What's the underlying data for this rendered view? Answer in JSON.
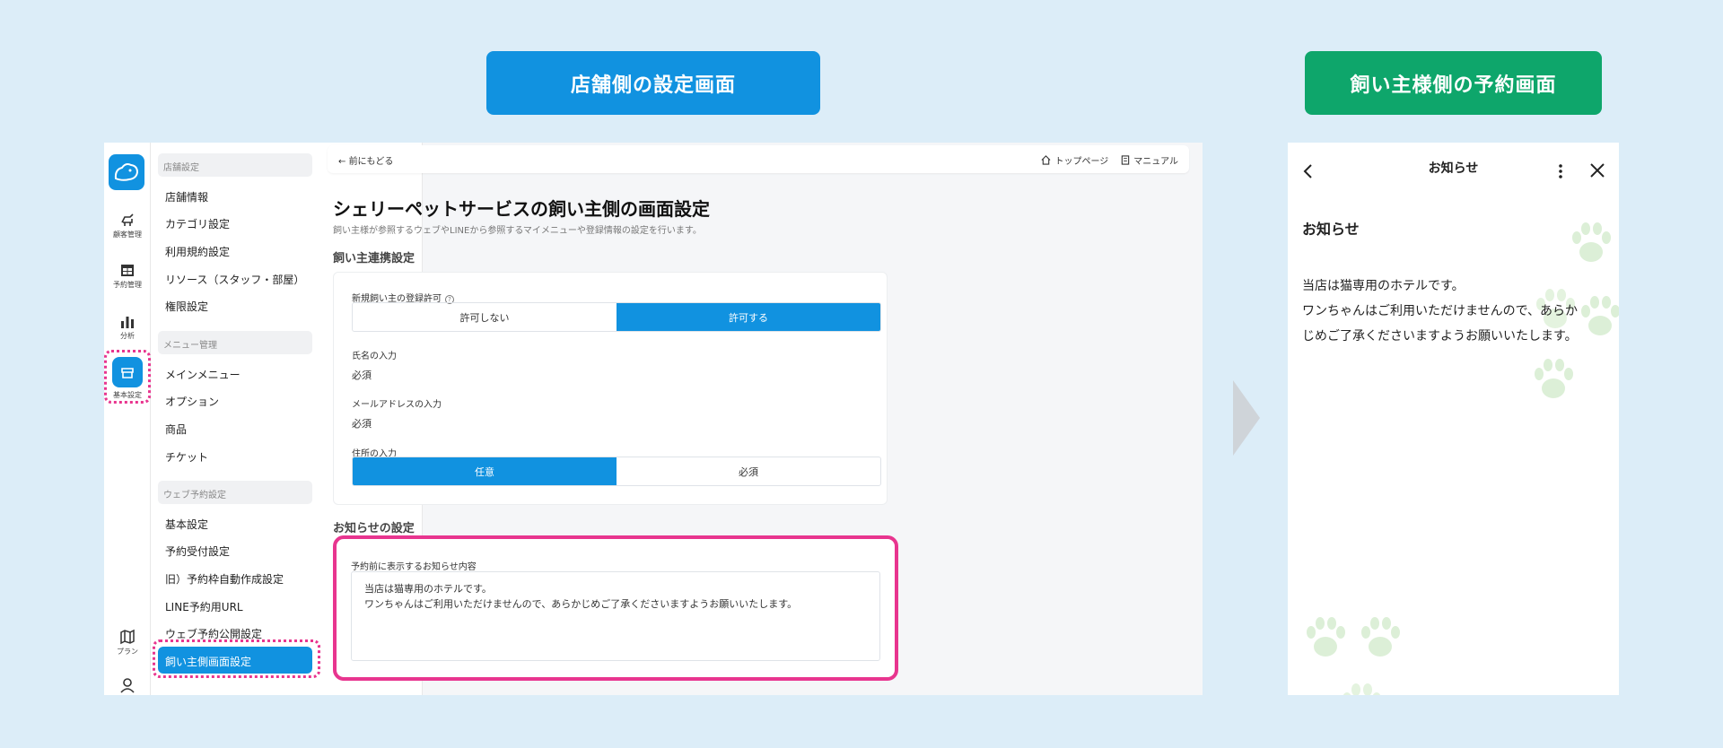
{
  "banners": {
    "store": "店舗側の設定画面",
    "owner": "飼い主様側の予約画面"
  },
  "colors": {
    "primary": "#1192e0",
    "owner_banner": "#0ea66b",
    "highlight": "#e8358f",
    "background": "#dcedf8"
  },
  "iconbar": {
    "items": [
      {
        "label": "顧客管理",
        "icon": "dog-icon"
      },
      {
        "label": "予約管理",
        "icon": "calendar-icon"
      },
      {
        "label": "分析",
        "icon": "bar-chart-icon"
      },
      {
        "label": "基本設定",
        "icon": "store-icon",
        "active": true
      },
      {
        "label": "プラン",
        "icon": "map-icon"
      }
    ]
  },
  "menu": {
    "sections": [
      {
        "title": "店舗設定",
        "items": [
          "店舗情報",
          "カテゴリ設定",
          "利用規約設定",
          "リソース（スタッフ・部屋）",
          "権限設定"
        ]
      },
      {
        "title": "メニュー管理",
        "items": [
          "メインメニュー",
          "オプション",
          "商品",
          "チケット"
        ]
      },
      {
        "title": "ウェブ予約設定",
        "items": [
          "基本設定",
          "予約受付設定",
          "旧）予約枠自動作成設定",
          "LINE予約用URL",
          "ウェブ予約公開設定",
          "飼い主側画面設定"
        ]
      }
    ],
    "active_item": "飼い主側画面設定"
  },
  "topbar": {
    "back": "前にもどる",
    "top_page": "トップページ",
    "manual": "マニュアル"
  },
  "page": {
    "title": "シェリーペットサービスの飼い主側の画面設定",
    "description": "飼い主様が参照するウェブやLINEから参照するマイメニューや登録情報の設定を行います。",
    "linkage_section": "飼い主連携設定",
    "registration_label": "新規飼い主の登録許可",
    "registration_options": [
      "許可しない",
      "許可する"
    ],
    "registration_selected": "許可する",
    "name_label": "氏名の入力",
    "name_value": "必須",
    "email_label": "メールアドレスの入力",
    "email_value": "必須",
    "address_label": "住所の入力",
    "address_options": [
      "任意",
      "必須"
    ],
    "address_selected": "任意",
    "notice_section": "お知らせの設定",
    "notice_label": "予約前に表示するお知らせ内容",
    "notice_line1": "当店は猫専用のホテルです。",
    "notice_line2": "ワンちゃんはご利用いただけませんので、あらかじめご了承くださいますようお願いいたします。"
  },
  "phone": {
    "header_title": "お知らせ",
    "heading": "お知らせ",
    "body_line1": "当店は猫専用のホテルです。",
    "body_line2": "ワンちゃんはご利用いただけませんので、あらか",
    "body_line3": "じめご了承くださいますようお願いいたします。"
  }
}
